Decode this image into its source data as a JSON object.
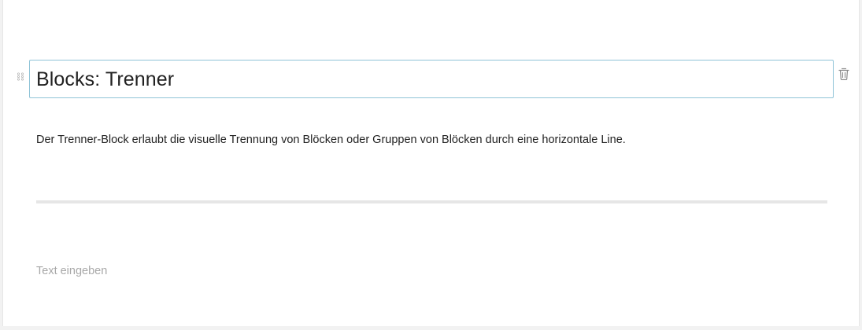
{
  "blocks": {
    "heading": {
      "text": "Blocks: Trenner",
      "drag_handle_icon": "drag-dots-icon",
      "delete_icon": "trash-icon"
    },
    "paragraph": {
      "text": "Der Trenner-Block erlaubt die visuelle Trennung von Blöcken oder Gruppen von Blöcken durch eine horizontale Line."
    },
    "separator": {
      "type": "horizontal-rule"
    },
    "empty_paragraph": {
      "placeholder": "Text eingeben"
    }
  },
  "colors": {
    "focus_border": "#8fc3d7",
    "text": "#222222",
    "placeholder": "#a8a8a8",
    "separator": "#e6e6e6",
    "icon": "#8a8a8a"
  }
}
